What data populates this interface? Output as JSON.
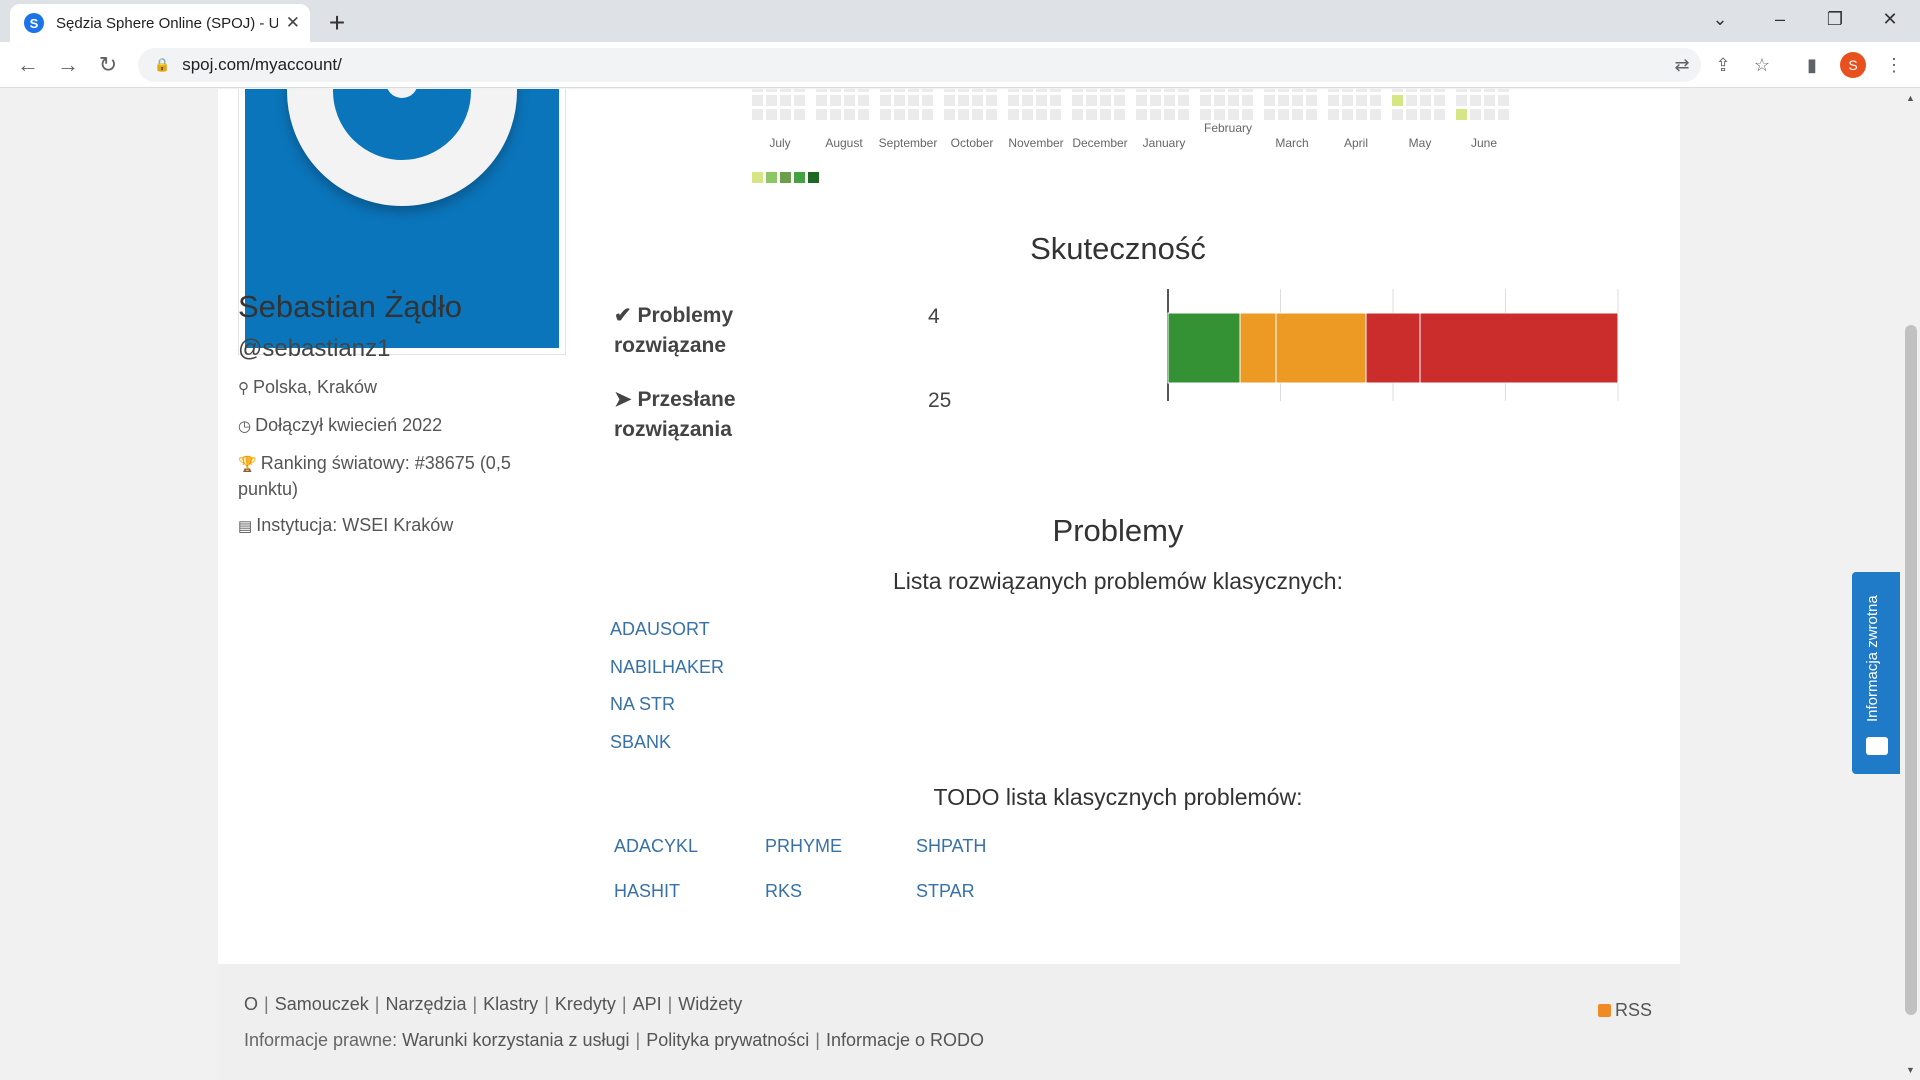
{
  "browser": {
    "tab_title": "Sędzia Sphere Online (SPOJ) - Uż",
    "favicon_letter": "S",
    "url": "spoj.com/myaccount/",
    "profile_letter": "S"
  },
  "profile": {
    "name": "Sebastian Żądło",
    "handle": "@sebastianz1",
    "location": "Polska, Kraków",
    "joined": "Dołączył kwiecień 2022",
    "ranking": "Ranking światowy: #38675 (0,5 punktu)",
    "institution": "Instytucja: WSEI Kraków"
  },
  "activity": {
    "months": [
      "July",
      "August",
      "September",
      "October",
      "November",
      "December",
      "January",
      "February",
      "March",
      "April",
      "May",
      "June"
    ],
    "legend_colors": [
      "#d6e685",
      "#8cc665",
      "#6a9e4a",
      "#44a340",
      "#1e6823"
    ]
  },
  "stats": {
    "title": "Skuteczność",
    "solved_label": "Problemy rozwiązane",
    "solved_value": "4",
    "submitted_label": "Przesłane rozwiązania",
    "submitted_value": "25",
    "bar_segments": [
      {
        "value": 4,
        "color": "#349235"
      },
      {
        "value": 2,
        "color": "#ec9a24"
      },
      {
        "value": 5,
        "color": "#ec9a24"
      },
      {
        "value": 3,
        "color": "#cb2c2c"
      },
      {
        "value": 11,
        "color": "#cb2c2c"
      }
    ]
  },
  "problems": {
    "title": "Problemy",
    "solved_title": "Lista rozwiązanych problemów klasycznych:",
    "solved": [
      "ADAUSORT",
      "NABILHAKER",
      "NA STR",
      "SBANK"
    ],
    "todo_title": "TODO lista klasycznych problemów:",
    "todo": [
      "ADACYKL",
      "PRHYME",
      "SHPATH",
      "HASHIT",
      "RKS",
      "STPAR"
    ]
  },
  "footer": {
    "links": [
      "O",
      "Samouczek",
      "Narzędzia",
      "Klastry",
      "Kredyty",
      "API",
      "Widżety"
    ],
    "legal_prefix": "Informacje prawne:",
    "legal_links": [
      "Warunki korzystania z usługi",
      "Polityka prywatności",
      "Informacje o RODO"
    ],
    "rss": "RSS"
  },
  "feedback": {
    "label": "Informacja zwrotna"
  }
}
